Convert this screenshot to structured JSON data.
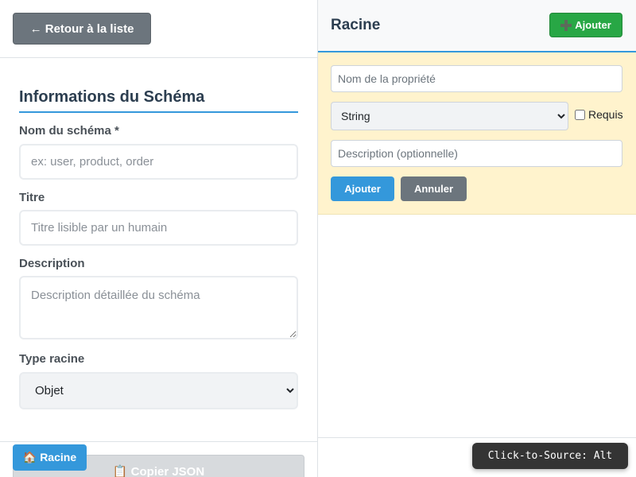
{
  "colors": {
    "accent": "#3498db",
    "success": "#28a745",
    "secondary": "#6c757d",
    "form_highlight": "#fff3cd"
  },
  "left": {
    "back_button": "← Retour à la liste",
    "section_title": "Informations du Schéma",
    "schema_name": {
      "label": "Nom du schéma *",
      "placeholder": "ex: user, product, order",
      "value": ""
    },
    "title": {
      "label": "Titre",
      "placeholder": "Titre lisible par un humain",
      "value": ""
    },
    "description": {
      "label": "Description",
      "placeholder": "Description détaillée du schéma",
      "value": ""
    },
    "root_type": {
      "label": "Type racine",
      "selected": "Objet"
    },
    "copy_json_button": "📋 Copier JSON"
  },
  "right": {
    "panel_title": "Racine",
    "add_button": "Ajouter",
    "add_button_icon": "plus-icon",
    "add_form": {
      "name_placeholder": "Nom de la propriété",
      "type_selected": "String",
      "required_label": "Requis",
      "required_checked": false,
      "description_placeholder": "Description (optionnelle)",
      "submit": "Ajouter",
      "cancel": "Annuler"
    },
    "breadcrumb_root": "🏠 Racine"
  },
  "tooltip": "Click-to-Source: Alt"
}
